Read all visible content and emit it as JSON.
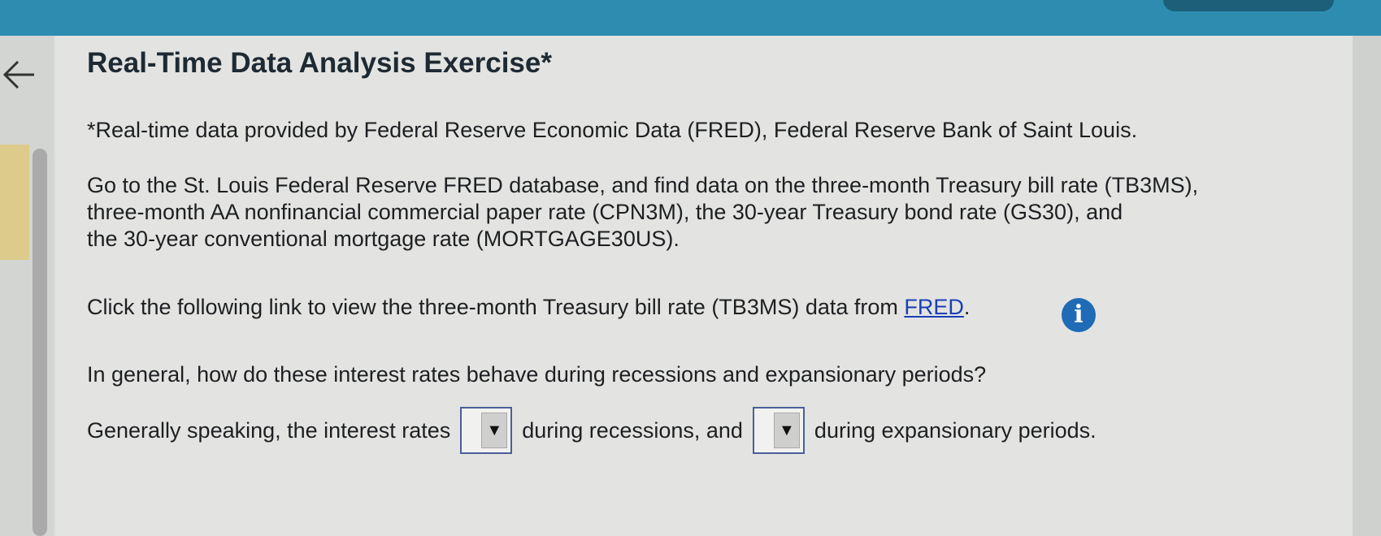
{
  "page": {
    "title": "Real-Time Data Analysis Exercise*",
    "source_note": "*Real-time data provided by Federal Reserve Economic Data (FRED), Federal Reserve Bank of Saint Louis.",
    "instructions": [
      "Go to the St. Louis Federal Reserve FRED database, and find data on the three-month Treasury bill rate (TB3MS),",
      "three-month AA nonfinancial commercial paper rate (CPN3M), the 30-year Treasury bond rate (GS30), and",
      "the 30-year conventional mortgage rate (MORTGAGE30US)."
    ],
    "link_sentence": "Click the following link to view the three-month Treasury bill rate (TB3MS) data from ",
    "link_text": "FRED",
    "link_suffix": ".",
    "question": "In general, how do these interest rates behave during recessions and expansionary periods?",
    "answer": {
      "part1": "Generally speaking, the interest rates",
      "part2": "during recessions, and",
      "part3": "during expansionary periods.",
      "dropdown1_value": "",
      "dropdown2_value": ""
    }
  },
  "icons": {
    "back": "back-arrow-icon",
    "info": "info-icon",
    "dropdown_arrow": "▼"
  },
  "colors": {
    "top_bar": "#2e8cb0",
    "link": "#1a3fb8",
    "info_icon": "#1f6bb6"
  }
}
